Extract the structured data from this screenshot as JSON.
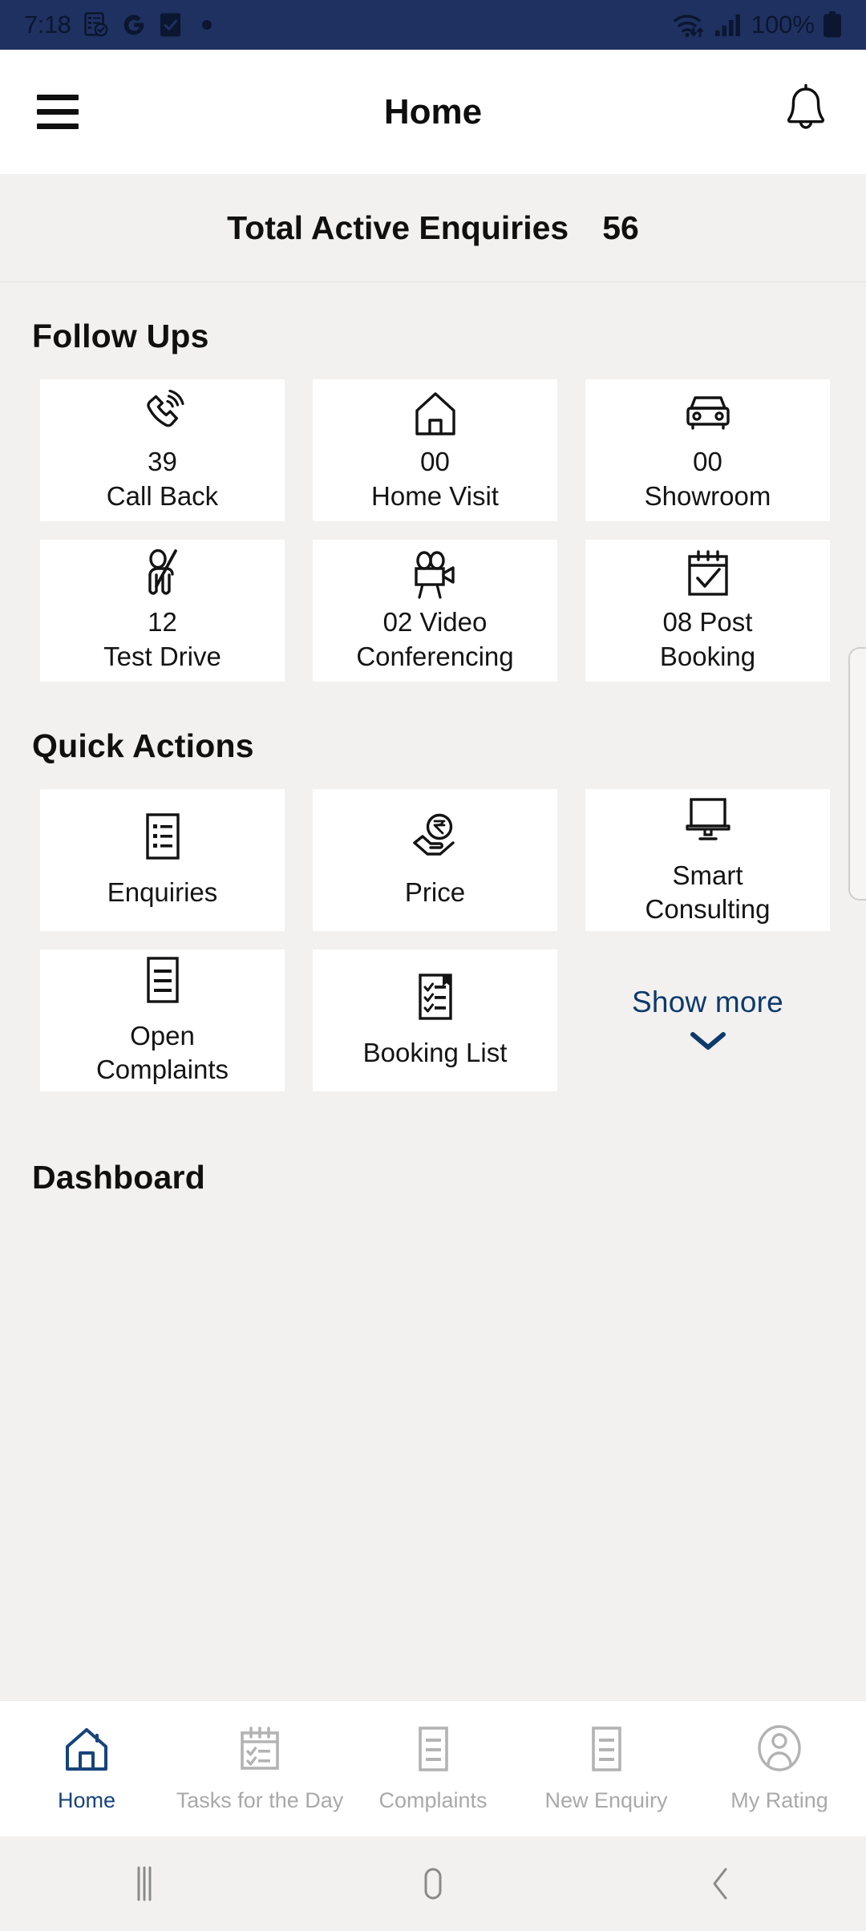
{
  "statusbar": {
    "time": "7:18",
    "battery": "100%",
    "icons": [
      "note-check-icon",
      "google-icon",
      "checkbox-icon",
      "dot-icon",
      "wifi-icon",
      "signal-icon",
      "battery-icon"
    ]
  },
  "appbar": {
    "title": "Home",
    "menu_icon": "hamburger-menu-icon",
    "notification_icon": "bell-icon"
  },
  "total_enquiries": {
    "label": "Total Active Enquiries",
    "value": "56"
  },
  "follow_ups": {
    "title": "Follow Ups",
    "items": [
      {
        "icon": "phone-call-icon",
        "count": "39",
        "label": "Call Back"
      },
      {
        "icon": "home-icon",
        "count": "00",
        "label": "Home Visit"
      },
      {
        "icon": "car-icon",
        "count": "00",
        "label": "Showroom"
      },
      {
        "icon": "test-drive-icon",
        "count": "12",
        "label": "Test Drive"
      },
      {
        "icon": "video-camera-icon",
        "count": "02 Video",
        "label": "Conferencing"
      },
      {
        "icon": "calendar-check-icon",
        "count": "08 Post",
        "label": "Booking"
      }
    ]
  },
  "quick_actions": {
    "title": "Quick Actions",
    "items": [
      {
        "icon": "list-document-icon",
        "label": "Enquiries"
      },
      {
        "icon": "rupee-hand-icon",
        "label": "Price"
      },
      {
        "icon": "monitor-icon",
        "label_line1": "Smart",
        "label_line2": "Consulting"
      },
      {
        "icon": "document-lines-icon",
        "label_line1": "Open",
        "label_line2": "Complaints"
      },
      {
        "icon": "checklist-icon",
        "label": "Booking List"
      }
    ],
    "show_more": {
      "label": "Show more",
      "icon": "chevron-down-icon"
    }
  },
  "dashboard": {
    "title": "Dashboard"
  },
  "bottom_nav": {
    "items": [
      {
        "icon": "home-icon",
        "label": "Home",
        "active": true
      },
      {
        "icon": "tasks-icon",
        "label": "Tasks for the Day",
        "active": false
      },
      {
        "icon": "complaints-icon",
        "label": "Complaints",
        "active": false
      },
      {
        "icon": "enquiry-icon",
        "label": "New Enquiry",
        "active": false
      },
      {
        "icon": "person-icon",
        "label": "My Rating",
        "active": false
      }
    ]
  },
  "system_nav": {
    "recents": "recents-icon",
    "home": "home-circle-icon",
    "back": "back-chevron-icon"
  },
  "colors": {
    "statusbar_bg": "#1E3160",
    "page_bg": "#F2F1EF",
    "card_bg": "#FFFFFF",
    "accent_navy": "#0E3A6B",
    "nav_active": "#17447A",
    "nav_inactive": "#A9A9A9"
  }
}
